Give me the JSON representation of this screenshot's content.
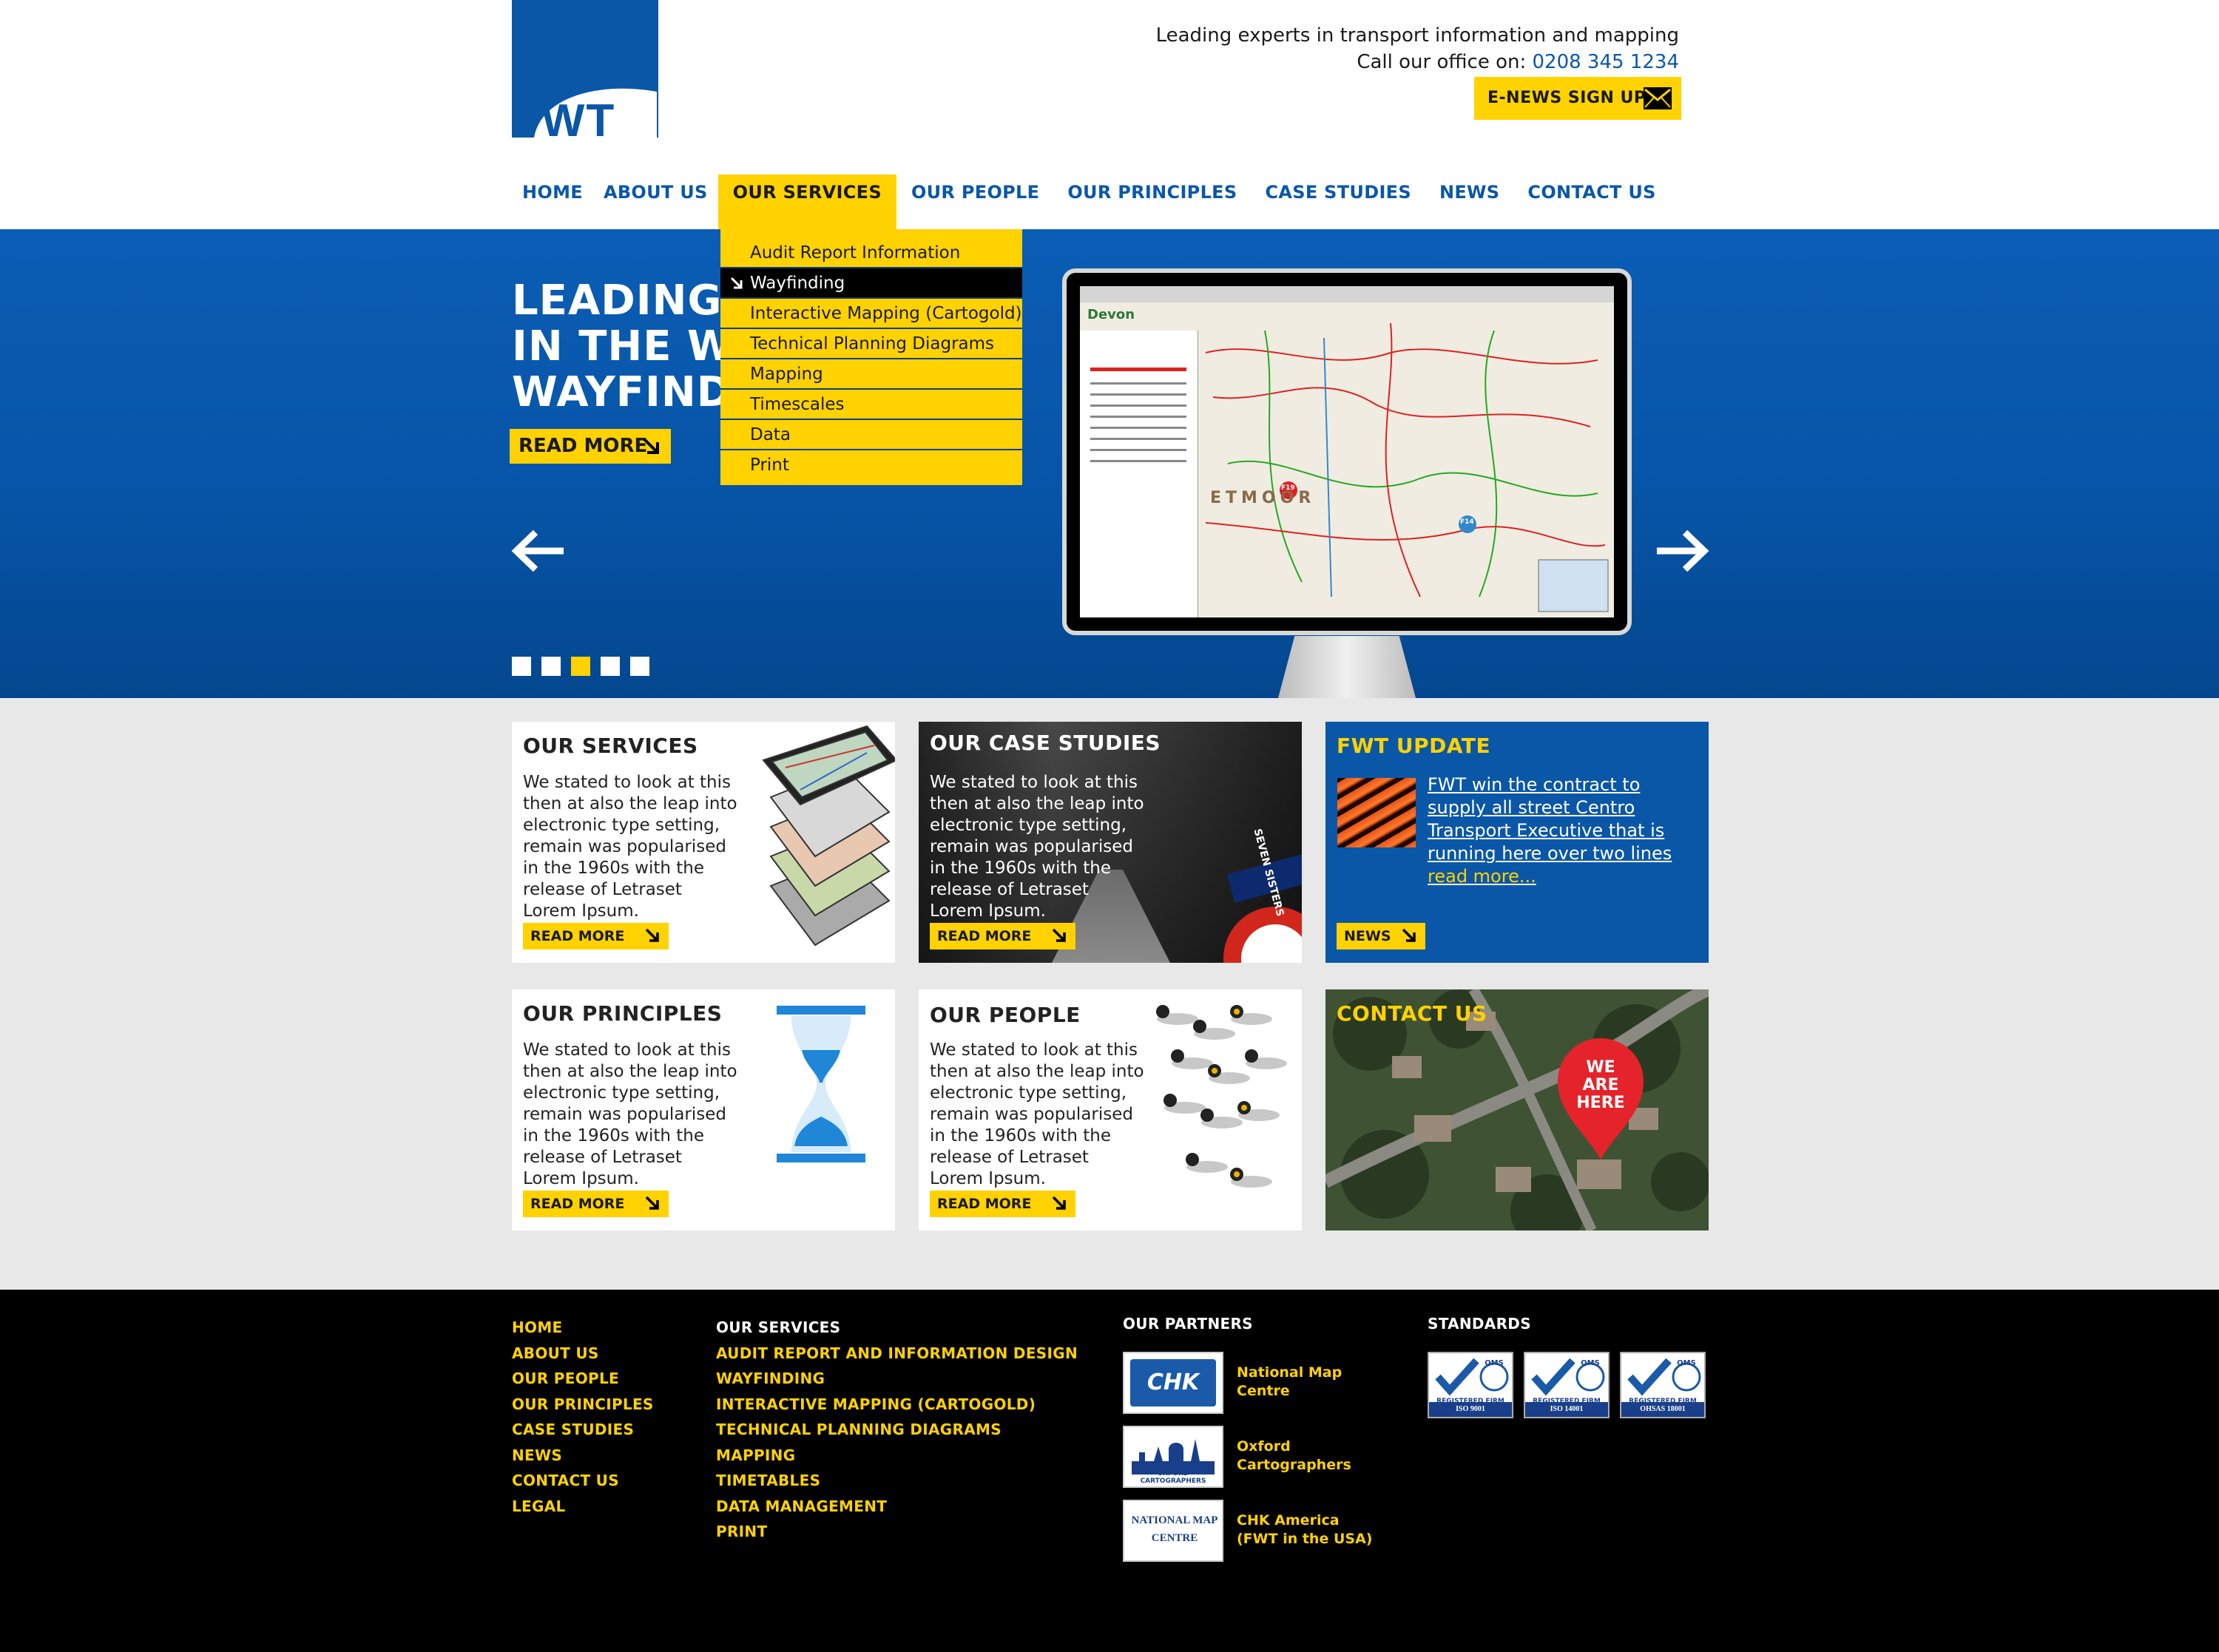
{
  "brand": {
    "logo_text": "FWT",
    "primary": "#0a57a8",
    "accent": "#ffd200"
  },
  "header": {
    "tagline": "Leading experts in transport information and mapping",
    "call_label": "Call our office on:",
    "phone": "0208 345 1234",
    "enews_label": "E-NEWS SIGN UP"
  },
  "nav": [
    "HOME",
    "ABOUT US",
    "OUR SERVICES",
    "OUR PEOPLE",
    "OUR PRINCIPLES",
    "CASE STUDIES",
    "NEWS",
    "CONTACT US"
  ],
  "dropdown": [
    "Audit Report Information",
    "Wayfinding",
    "Interactive Mapping (Cartogold)",
    "Technical Planning Diagrams",
    "Mapping",
    "Timescales",
    "Data",
    "Print"
  ],
  "hero": {
    "title_lines": [
      "LEADING THE WAY",
      "IN THE WORLD OF",
      "WAYFINDING"
    ],
    "read_more": "READ MORE",
    "screen_app": "Devon",
    "screen_map_label": "ETMOOR",
    "screen_markers": [
      "F19",
      "F14"
    ],
    "slides": 5,
    "active_slide": 3
  },
  "cards": {
    "services": {
      "title": "OUR SERVICES",
      "body": "We stated to look at this then at also the leap into electronic type setting, remain was popularised in the 1960s with the release of Letraset Lorem Ipsum.",
      "btn": "READ MORE"
    },
    "case_studies": {
      "title": "OUR CASE STUDIES",
      "body": "We stated to look at this then at also the leap into electronic type setting, remain was popularised in the 1960s with the release of Letraset Lorem Ipsum.",
      "btn": "READ MORE",
      "sign_text": "SEVEN SISTERS"
    },
    "update": {
      "title": "FWT UPDATE",
      "body": "FWT win the contract to supply all street  Centro Transport Executive that is running  here over two lines ",
      "link": "read more...",
      "btn": "NEWS"
    },
    "principles": {
      "title": "OUR PRINCIPLES",
      "body": "We stated to look at this then at also the leap into electronic type setting, remain was popularised in the 1960s with the release of Letraset Lorem Ipsum.",
      "btn": "READ MORE"
    },
    "people": {
      "title": "OUR PEOPLE",
      "body": "We stated to look at this then at also the leap into electronic type setting, remain was popularised in the 1960s with the release of Letraset Lorem Ipsum.",
      "btn": "READ MORE"
    },
    "contact": {
      "title": "CONTACT US",
      "pin_lines": [
        "WE",
        "ARE",
        "HERE"
      ]
    }
  },
  "footer": {
    "col1": [
      "HOME",
      "ABOUT US",
      "OUR PEOPLE",
      "OUR PRINCIPLES",
      "CASE STUDIES",
      "NEWS",
      "CONTACT US",
      "LEGAL"
    ],
    "col2_head": "OUR SERVICES",
    "col2": [
      "AUDIT REPORT AND INFORMATION DESIGN",
      "WAYFINDING",
      "INTERACTIVE MAPPING (CARTOGOLD)",
      "TECHNICAL PLANNING DIAGRAMS",
      "MAPPING",
      "TIMETABLES",
      "DATA MANAGEMENT",
      "PRINT"
    ],
    "partners_head": "OUR PARTNERS",
    "partners": [
      {
        "logo": "CHK",
        "lines": [
          "National Map",
          "Centre"
        ]
      },
      {
        "logo": "OXFORD CARTOGRAPHERS",
        "lines": [
          "Oxford",
          "Cartographers"
        ]
      },
      {
        "logo": "NATIONAL MAP CENTRE",
        "lines": [
          "CHK America",
          "(FWT in the USA)"
        ]
      }
    ],
    "standards_head": "STANDARDS",
    "standards": [
      "ISO 9001",
      "ISO 14001",
      "OHSAS 18001"
    ],
    "standards_mark": "QMS",
    "standards_caption": "REGISTERED FIRM"
  }
}
